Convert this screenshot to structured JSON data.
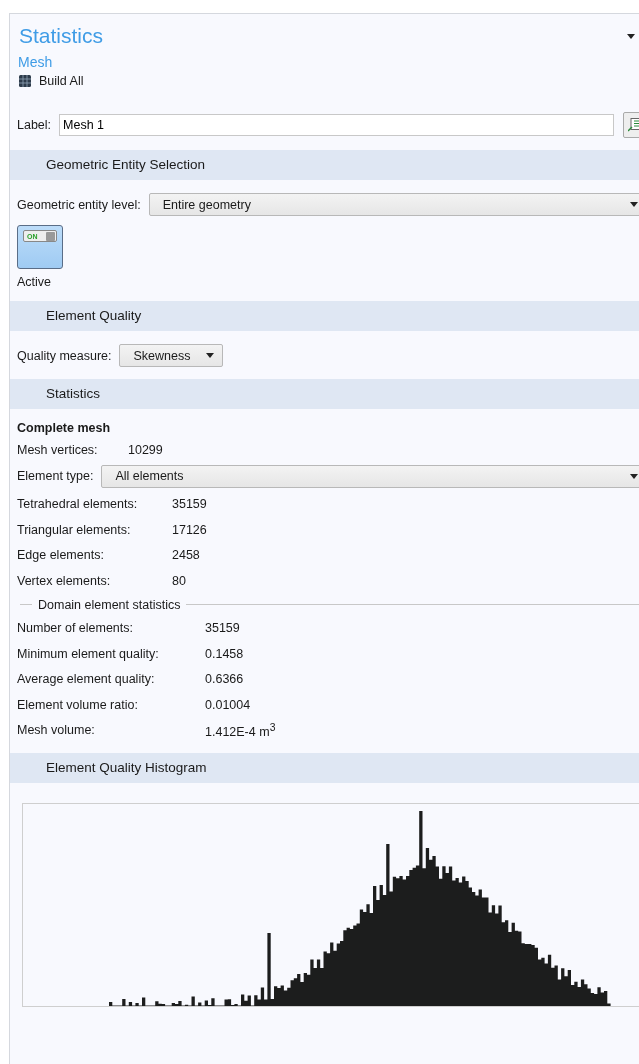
{
  "header": {
    "title": "Statistics",
    "breadcrumb": "Mesh",
    "build_button": "Build All"
  },
  "label_field": {
    "label": "Label:",
    "value": "Mesh 1"
  },
  "entity_selection": {
    "title": "Geometric Entity Selection",
    "level_label": "Geometric entity level:",
    "level_value": "Entire geometry",
    "toggle": {
      "text": "ON",
      "on": true,
      "caption": "Active"
    }
  },
  "element_quality": {
    "title": "Element Quality",
    "measure_label": "Quality measure:",
    "measure_value": "Skewness"
  },
  "statistics": {
    "title": "Statistics",
    "group_title": "Complete mesh",
    "vertices": {
      "label": "Mesh vertices:",
      "value": "10299"
    },
    "element_type": {
      "label": "Element type:",
      "value": "All elements"
    },
    "counts": [
      {
        "label": "Tetrahedral elements:",
        "value": "35159"
      },
      {
        "label": "Triangular elements:",
        "value": "17126"
      },
      {
        "label": "Edge elements:",
        "value": "2458"
      },
      {
        "label": "Vertex elements:",
        "value": "80"
      }
    ],
    "domain_title": "Domain element statistics",
    "domain_rows": [
      {
        "label": "Number of elements:",
        "value": "35159"
      },
      {
        "label": "Minimum element quality:",
        "value": "0.1458"
      },
      {
        "label": "Average element quality:",
        "value": "0.6366"
      },
      {
        "label": "Element volume ratio:",
        "value": "0.01004"
      },
      {
        "label": "Mesh volume:",
        "value": "1.412E-4 m$^{3}$"
      }
    ]
  },
  "histogram": {
    "title": "Element Quality Histogram"
  }
}
